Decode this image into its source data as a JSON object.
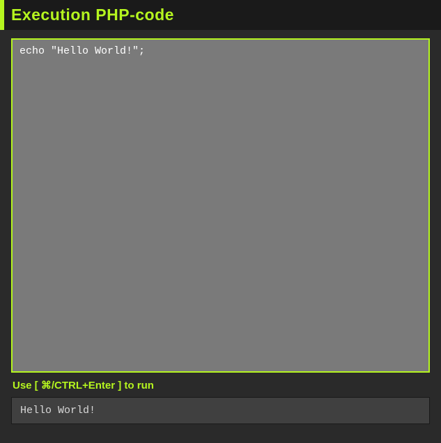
{
  "header": {
    "title": "Execution PHP-code"
  },
  "editor": {
    "code": "echo \"Hello World!\";"
  },
  "hint": {
    "text": "Use [ ⌘/CTRL+Enter ] to run"
  },
  "output": {
    "result": "Hello World!"
  }
}
